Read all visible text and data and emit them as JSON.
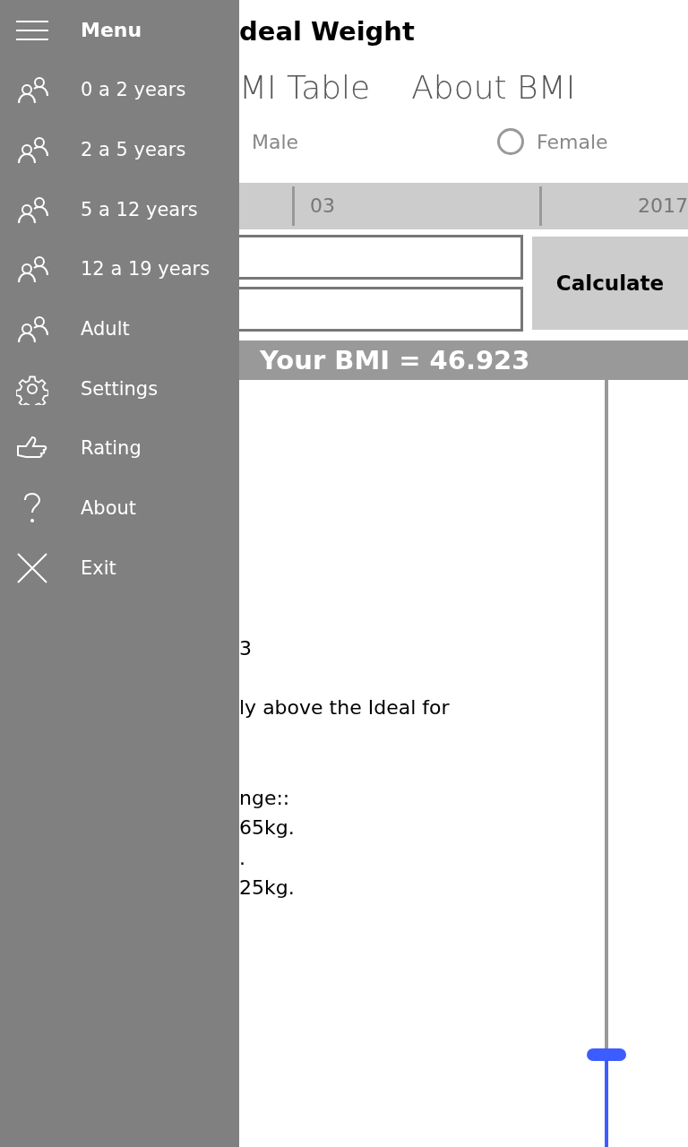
{
  "title": "deal Weight",
  "tabs": [
    {
      "label": "MI Table"
    },
    {
      "label": "About BMI"
    }
  ],
  "male_label": "Male",
  "female": {
    "label": "Female",
    "selected": false
  },
  "date": {
    "month": "03",
    "year": "2017"
  },
  "calculate_button": "Calculate",
  "result": "Your BMI = 46.923",
  "paragraphs": [
    [
      "3"
    ],
    [
      "ly above the Ideal for"
    ],
    [
      "nge::",
      "65kg.",
      ".",
      "25kg."
    ]
  ],
  "slider": {
    "level": 0.12
  },
  "menu": {
    "title": "Menu",
    "items": [
      {
        "kind": "people",
        "label": "0 a 2 years"
      },
      {
        "kind": "people",
        "label": "2 a 5 years"
      },
      {
        "kind": "people",
        "label": "5 a 12 years"
      },
      {
        "kind": "people",
        "label": "12 a 19 years"
      },
      {
        "kind": "people",
        "label": "Adult"
      },
      {
        "kind": "settings",
        "label": "Settings"
      },
      {
        "kind": "rating",
        "label": "Rating"
      },
      {
        "kind": "about",
        "label": "About"
      },
      {
        "kind": "exit",
        "label": "Exit"
      }
    ]
  }
}
